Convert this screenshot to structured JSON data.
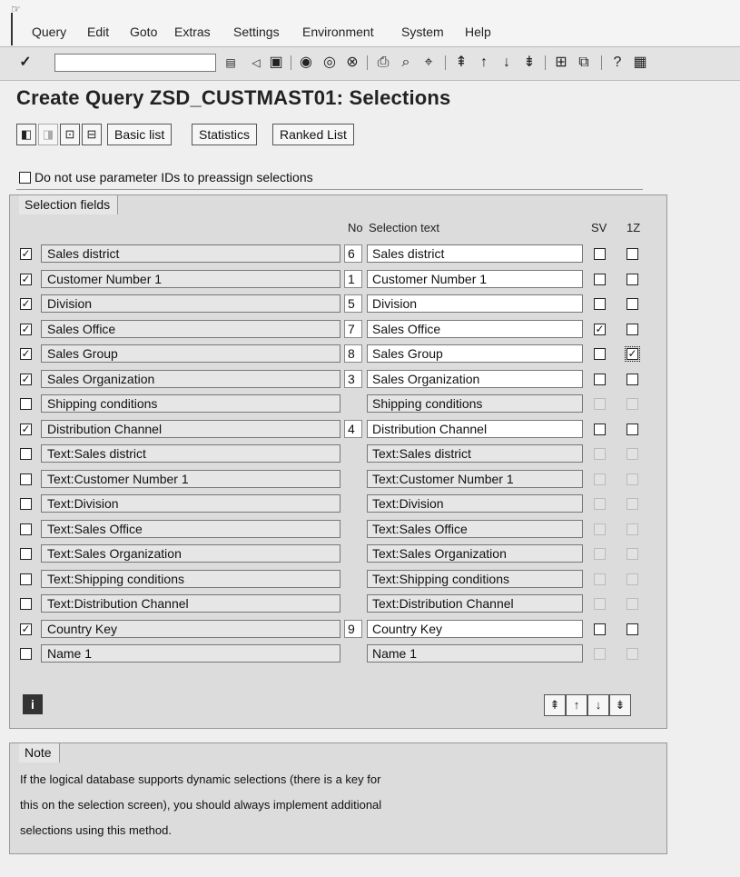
{
  "menu": {
    "system_icon": "menu-icon",
    "items": [
      {
        "label": "Query"
      },
      {
        "label": "Edit"
      },
      {
        "label": "Goto"
      },
      {
        "label": "Extras"
      },
      {
        "label": "Settings"
      },
      {
        "label": "Environment"
      },
      {
        "label": "System"
      },
      {
        "label": "Help"
      }
    ]
  },
  "toolbar": {
    "command_field_value": "",
    "icons": [
      "enter-icon",
      "save-icon",
      "back-icon",
      "exit-icon",
      "cancel-icon",
      "print-icon",
      "find-icon",
      "find-next-icon",
      "first-page-icon",
      "previous-page-icon",
      "next-page-icon",
      "last-page-icon",
      "create-session-icon",
      "shortcut-icon",
      "help-icon",
      "layout-menu-icon"
    ]
  },
  "page": {
    "title": "Create Query ZSD_CUSTMAST01: Selections"
  },
  "app_toolbar": {
    "icons": [
      "prev-screen-icon",
      "next-screen-icon",
      "field-groups-icon",
      "output-fields-icon"
    ],
    "buttons": [
      "Basic list",
      "Statistics",
      "Ranked List"
    ]
  },
  "parameter_option": {
    "label": "Do not use parameter IDs to preassign selections",
    "checked": false
  },
  "selection_fields": {
    "group_title": "Selection fields",
    "headers": {
      "no": "No",
      "text": "Selection text",
      "sv": "SV",
      "one_z": "1Z"
    },
    "rows": [
      {
        "selected": true,
        "field": "Sales district",
        "no": "6",
        "text": "Sales district",
        "sv": false,
        "one_z": false,
        "editable": true
      },
      {
        "selected": true,
        "field": "Customer Number 1",
        "no": "1",
        "text": "Customer Number 1",
        "sv": false,
        "one_z": false,
        "editable": true
      },
      {
        "selected": true,
        "field": "Division",
        "no": "5",
        "text": "Division",
        "sv": false,
        "one_z": false,
        "editable": true
      },
      {
        "selected": true,
        "field": "Sales Office",
        "no": "7",
        "text": "Sales Office",
        "sv": true,
        "one_z": false,
        "editable": true
      },
      {
        "selected": true,
        "field": "Sales Group",
        "no": "8",
        "text": "Sales Group",
        "sv": false,
        "one_z": true,
        "editable": true
      },
      {
        "selected": true,
        "field": "Sales Organization",
        "no": "3",
        "text": "Sales Organization",
        "sv": false,
        "one_z": false,
        "editable": true
      },
      {
        "selected": false,
        "field": "Shipping conditions",
        "no": "",
        "text": "Shipping conditions",
        "sv": false,
        "one_z": false,
        "editable": false
      },
      {
        "selected": true,
        "field": "Distribution Channel",
        "no": "4",
        "text": "Distribution Channel",
        "sv": false,
        "one_z": false,
        "editable": true
      },
      {
        "selected": false,
        "field": "Text:Sales district",
        "no": "",
        "text": "Text:Sales district",
        "sv": false,
        "one_z": false,
        "editable": false
      },
      {
        "selected": false,
        "field": "Text:Customer Number 1",
        "no": "",
        "text": "Text:Customer Number 1",
        "sv": false,
        "one_z": false,
        "editable": false
      },
      {
        "selected": false,
        "field": "Text:Division",
        "no": "",
        "text": "Text:Division",
        "sv": false,
        "one_z": false,
        "editable": false
      },
      {
        "selected": false,
        "field": "Text:Sales Office",
        "no": "",
        "text": "Text:Sales Office",
        "sv": false,
        "one_z": false,
        "editable": false
      },
      {
        "selected": false,
        "field": "Text:Sales Organization",
        "no": "",
        "text": "Text:Sales Organization",
        "sv": false,
        "one_z": false,
        "editable": false
      },
      {
        "selected": false,
        "field": "Text:Shipping conditions",
        "no": "",
        "text": "Text:Shipping conditions",
        "sv": false,
        "one_z": false,
        "editable": false
      },
      {
        "selected": false,
        "field": "Text:Distribution Channel",
        "no": "",
        "text": "Text:Distribution Channel",
        "sv": false,
        "one_z": false,
        "editable": false
      },
      {
        "selected": true,
        "field": "Country Key",
        "no": "9",
        "text": "Country Key",
        "sv": false,
        "one_z": false,
        "editable": true
      },
      {
        "selected": false,
        "field": "Name 1",
        "no": "",
        "text": "Name 1",
        "sv": false,
        "one_z": false,
        "editable": false
      }
    ],
    "bottom_icons": [
      "information-icon",
      "first-page-icon",
      "previous-page-icon",
      "next-page-icon",
      "last-page-icon"
    ]
  },
  "note": {
    "title": "Note",
    "lines": [
      "If the logical database supports dynamic selections (there is a key for",
      "this on the selection screen), you should always implement additional",
      "selections using this method."
    ]
  }
}
